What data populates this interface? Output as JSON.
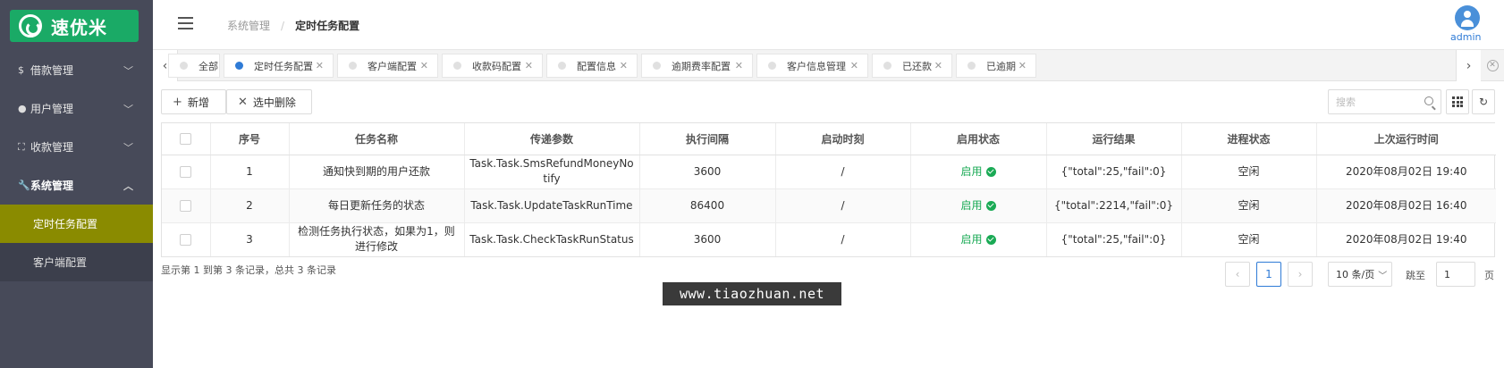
{
  "brand": {
    "name": "速优米",
    "color": "#1aaa66"
  },
  "sidebar": {
    "items": [
      {
        "icon": "$",
        "icon_name": "dollar-icon",
        "label": "借款管理"
      },
      {
        "icon": "●",
        "icon_name": "user-icon",
        "label": "用户管理"
      },
      {
        "icon": "⛶",
        "icon_name": "scan-icon",
        "label": "收款管理"
      },
      {
        "icon": "🔧",
        "icon_name": "wrench-icon",
        "label": "系统管理",
        "open": true
      }
    ],
    "submenu": [
      {
        "label": "定时任务配置",
        "active": true
      },
      {
        "label": "客户端配置"
      }
    ],
    "active_color": "#8a8b00"
  },
  "header": {
    "breadcrumb": {
      "parent": "系统管理",
      "sep": "/",
      "current": "定时任务配置"
    },
    "user": "admin"
  },
  "tabs": [
    {
      "label": "全部",
      "active": false,
      "closable": false
    },
    {
      "label": "定时任务配置",
      "active": true,
      "closable": true
    },
    {
      "label": "客户端配置",
      "active": false,
      "closable": true
    },
    {
      "label": "收款码配置",
      "active": false,
      "closable": true
    },
    {
      "label": "配置信息",
      "active": false,
      "closable": true
    },
    {
      "label": "逾期费率配置",
      "active": false,
      "closable": true
    },
    {
      "label": "客户信息管理",
      "active": false,
      "closable": true
    },
    {
      "label": "已还款",
      "active": false,
      "closable": true
    },
    {
      "label": "已逾期",
      "active": false,
      "closable": true
    }
  ],
  "toolbar": {
    "add_label": "新增",
    "delete_label": "选中删除",
    "search_placeholder": "搜索"
  },
  "table": {
    "columns": [
      "序号",
      "任务名称",
      "传递参数",
      "执行间隔",
      "启动时刻",
      "启用状态",
      "运行结果",
      "进程状态",
      "上次运行时间"
    ],
    "rows": [
      {
        "no": "1",
        "name": "通知快到期的用户还款",
        "param": "Task.Task.SmsRefundMoneyNotify",
        "interval": "3600",
        "start": "/",
        "status": "启用",
        "result": "{\"total\":25,\"fail\":0}",
        "process": "空闲",
        "last_run": "2020年08月02日 19:40"
      },
      {
        "no": "2",
        "name": "每日更新任务的状态",
        "param": "Task.Task.UpdateTaskRunTime",
        "interval": "86400",
        "start": "/",
        "status": "启用",
        "result": "{\"total\":2214,\"fail\":0}",
        "process": "空闲",
        "last_run": "2020年08月02日 16:40"
      },
      {
        "no": "3",
        "name": "检测任务执行状态，如果为1，则进行修改",
        "param": "Task.Task.CheckTaskRunStatus",
        "interval": "3600",
        "start": "/",
        "status": "启用",
        "result": "{\"total\":25,\"fail\":0}",
        "process": "空闲",
        "last_run": "2020年08月02日 19:40"
      }
    ]
  },
  "footer": {
    "summary": "显示第 1 到第 3 条记录，总共 3 条记录",
    "prev": "‹",
    "current_page": "1",
    "next": "›",
    "page_size": "10 条/页",
    "jump_label": "跳至",
    "jump_value": "1",
    "jump_unit": "页"
  },
  "watermark": "www.tiaozhuan.net"
}
